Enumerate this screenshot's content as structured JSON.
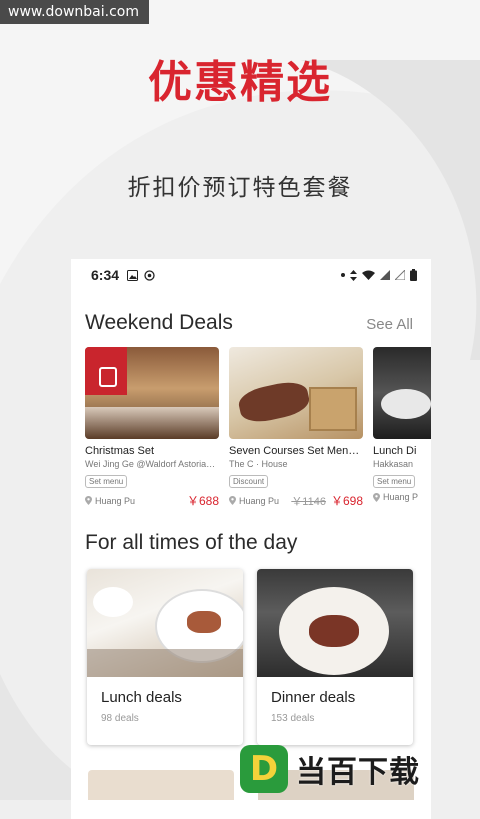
{
  "watermark": "www.downbai.com",
  "hero": {
    "title": "优惠精选",
    "subtitle": "折扣价预订特色套餐"
  },
  "status_bar": {
    "time": "6:34"
  },
  "weekend": {
    "title": "Weekend Deals",
    "see_all": "See All",
    "items": [
      {
        "name": "Christmas Set",
        "venue": "Wei Jing Ge @Waldorf Astoria…",
        "tag": "Set menu",
        "location": "Huang Pu",
        "original_price": "",
        "price": "￥688"
      },
      {
        "name": "Seven Courses Set Men…",
        "venue": "The C · House",
        "tag": "Discount",
        "location": "Huang Pu",
        "original_price": "￥1146",
        "price": "￥698"
      },
      {
        "name": "Lunch Di",
        "venue": "Hakkasan",
        "tag": "Set menu",
        "location": "Huang P",
        "original_price": "",
        "price": ""
      }
    ]
  },
  "alltimes": {
    "title": "For all times of the day",
    "cards": [
      {
        "title": "Lunch deals",
        "count": "98 deals"
      },
      {
        "title": "Dinner deals",
        "count": "153 deals"
      }
    ]
  },
  "logo": {
    "mark": "D",
    "text": "当百下载"
  },
  "colors": {
    "accent": "#d9252f",
    "logo_green": "#2a9b3c",
    "logo_yellow": "#f4d23a"
  },
  "icons": [
    "image-icon",
    "sync-icon",
    "dot-icon",
    "data-arrows-icon",
    "wifi-icon",
    "signal-icon",
    "battery-icon",
    "location-pin-icon"
  ]
}
